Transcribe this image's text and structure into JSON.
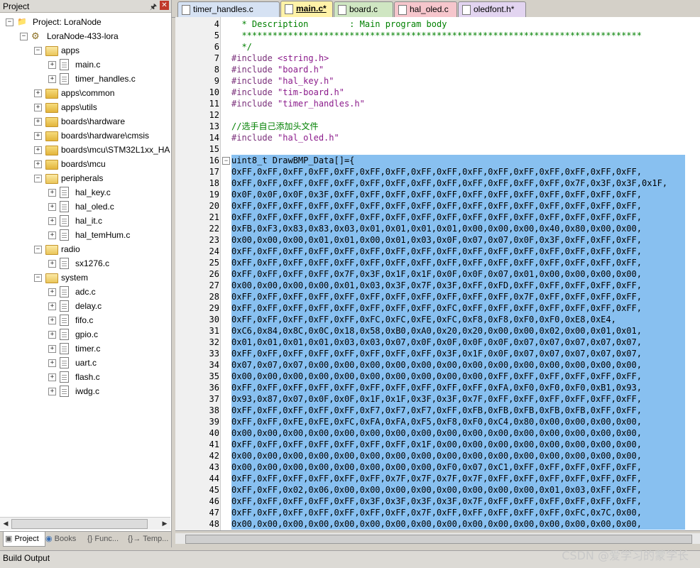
{
  "project_panel": {
    "title": "Project",
    "pin_icon": "pin-icon",
    "close_icon": "close-icon",
    "tree": [
      {
        "label": "Project: LoraNode",
        "depth": 0,
        "kind": "project",
        "expanded": true
      },
      {
        "label": "LoraNode-433-lora",
        "depth": 1,
        "kind": "target",
        "expanded": true
      },
      {
        "label": "apps",
        "depth": 2,
        "kind": "folder",
        "expanded": true
      },
      {
        "label": "main.c",
        "depth": 3,
        "kind": "file"
      },
      {
        "label": "timer_handles.c",
        "depth": 3,
        "kind": "file"
      },
      {
        "label": "apps\\common",
        "depth": 2,
        "kind": "folder",
        "expanded": false
      },
      {
        "label": "apps\\utils",
        "depth": 2,
        "kind": "folder",
        "expanded": false
      },
      {
        "label": "boards\\hardware",
        "depth": 2,
        "kind": "folder",
        "expanded": false
      },
      {
        "label": "boards\\hardware\\cmsis",
        "depth": 2,
        "kind": "folder",
        "expanded": false
      },
      {
        "label": "boards\\mcu\\STM32L1xx_HA",
        "depth": 2,
        "kind": "folder",
        "expanded": false
      },
      {
        "label": "boards\\mcu",
        "depth": 2,
        "kind": "folder",
        "expanded": false
      },
      {
        "label": "peripherals",
        "depth": 2,
        "kind": "folder",
        "expanded": true
      },
      {
        "label": "hal_key.c",
        "depth": 3,
        "kind": "file"
      },
      {
        "label": "hal_oled.c",
        "depth": 3,
        "kind": "file"
      },
      {
        "label": "hal_it.c",
        "depth": 3,
        "kind": "file"
      },
      {
        "label": "hal_temHum.c",
        "depth": 3,
        "kind": "file"
      },
      {
        "label": "radio",
        "depth": 2,
        "kind": "folder",
        "expanded": true
      },
      {
        "label": "sx1276.c",
        "depth": 3,
        "kind": "file"
      },
      {
        "label": "system",
        "depth": 2,
        "kind": "folder",
        "expanded": true
      },
      {
        "label": "adc.c",
        "depth": 3,
        "kind": "file"
      },
      {
        "label": "delay.c",
        "depth": 3,
        "kind": "file"
      },
      {
        "label": "fifo.c",
        "depth": 3,
        "kind": "file"
      },
      {
        "label": "gpio.c",
        "depth": 3,
        "kind": "file"
      },
      {
        "label": "timer.c",
        "depth": 3,
        "kind": "file"
      },
      {
        "label": "uart.c",
        "depth": 3,
        "kind": "file"
      },
      {
        "label": "flash.c",
        "depth": 3,
        "kind": "file"
      },
      {
        "label": "iwdg.c",
        "depth": 3,
        "kind": "file"
      }
    ],
    "tabs": [
      {
        "label": "Project",
        "icon": "project-icon",
        "active": true
      },
      {
        "label": "Books",
        "icon": "books-icon",
        "active": false
      },
      {
        "label": "{} Func...",
        "icon": "functions-icon",
        "active": false
      },
      {
        "label": "{}→ Temp...",
        "icon": "templates-icon",
        "active": false
      }
    ]
  },
  "editor_tabs": [
    {
      "label": "timer_handles.c",
      "color": "#d6e2f3",
      "active": false
    },
    {
      "label": "main.c*",
      "color": "#fff2a8",
      "active": true
    },
    {
      "label": "board.c",
      "color": "#cfe6c2",
      "active": false
    },
    {
      "label": "hal_oled.c",
      "color": "#f6c6cc",
      "active": false
    },
    {
      "label": "oledfont.h*",
      "color": "#e2d4f0",
      "active": false
    }
  ],
  "code_lines": [
    {
      "n": "4",
      "sel": false,
      "segs": [
        {
          "t": "  * Description        : Main program body",
          "c": "cm"
        }
      ]
    },
    {
      "n": "5",
      "sel": false,
      "segs": [
        {
          "t": "  ******************************************************************************",
          "c": "cm"
        }
      ]
    },
    {
      "n": "6",
      "sel": false,
      "segs": [
        {
          "t": "  */",
          "c": "cm"
        }
      ]
    },
    {
      "n": "7",
      "sel": false,
      "segs": [
        {
          "t": "#include ",
          "c": "pp"
        },
        {
          "t": "<string.h>",
          "c": "str"
        }
      ]
    },
    {
      "n": "8",
      "sel": false,
      "segs": [
        {
          "t": "#include ",
          "c": "pp"
        },
        {
          "t": "\"board.h\"",
          "c": "str"
        }
      ]
    },
    {
      "n": "9",
      "sel": false,
      "segs": [
        {
          "t": "#include ",
          "c": "pp"
        },
        {
          "t": "\"hal_key.h\"",
          "c": "str"
        }
      ]
    },
    {
      "n": "10",
      "sel": false,
      "segs": [
        {
          "t": "#include ",
          "c": "pp"
        },
        {
          "t": "\"tim-board.h\"",
          "c": "str"
        }
      ]
    },
    {
      "n": "11",
      "sel": false,
      "segs": [
        {
          "t": "#include ",
          "c": "pp"
        },
        {
          "t": "\"timer_handles.h\"",
          "c": "str"
        }
      ]
    },
    {
      "n": "12",
      "sel": false,
      "segs": [
        {
          "t": "",
          "c": "plain"
        }
      ]
    },
    {
      "n": "13",
      "sel": false,
      "segs": [
        {
          "t": "//选手自己添加头文件",
          "c": "cm"
        }
      ]
    },
    {
      "n": "14",
      "sel": false,
      "segs": [
        {
          "t": "#include ",
          "c": "pp"
        },
        {
          "t": "\"hal_oled.h\"",
          "c": "str"
        }
      ]
    },
    {
      "n": "15",
      "sel": false,
      "segs": [
        {
          "t": "",
          "c": "plain"
        }
      ]
    },
    {
      "n": "16",
      "sel": true,
      "fold": true,
      "segs": [
        {
          "t": "uint8_t DrawBMP_Data[]={",
          "c": "plain"
        }
      ]
    },
    {
      "n": "17",
      "sel": true,
      "segs": [
        {
          "t": "0xFF,0xFF,0xFF,0xFF,0xFF,0xFF,0xFF,0xFF,0xFF,0xFF,0xFF,0xFF,0xFF,0xFF,0xFF,0xFF,",
          "c": "plain"
        }
      ]
    },
    {
      "n": "18",
      "sel": true,
      "segs": [
        {
          "t": "0xFF,0xFF,0xFF,0xFF,0xFF,0xFF,0xFF,0xFF,0xFF,0xFF,0xFF,0xFF,0xFF,0x7F,0x3F,0x3F,0x1F,",
          "c": "plain"
        }
      ]
    },
    {
      "n": "19",
      "sel": true,
      "segs": [
        {
          "t": "0x0F,0x0F,0x0F,0x3F,0xFF,0xFF,0xFF,0xFF,0xFF,0xFF,0xFF,0xFF,0xFF,0xFF,0xFF,0xFF,",
          "c": "plain"
        }
      ]
    },
    {
      "n": "20",
      "sel": true,
      "segs": [
        {
          "t": "0xFF,0xFF,0xFF,0xFF,0xFF,0xFF,0xFF,0xFF,0xFF,0xFF,0xFF,0xFF,0xFF,0xFF,0xFF,0xFF,",
          "c": "plain"
        }
      ]
    },
    {
      "n": "21",
      "sel": true,
      "segs": [
        {
          "t": "0xFF,0xFF,0xFF,0xFF,0xFF,0xFF,0xFF,0xFF,0xFF,0xFF,0xFF,0xFF,0xFF,0xFF,0xFF,0xFF,",
          "c": "plain"
        }
      ]
    },
    {
      "n": "22",
      "sel": true,
      "segs": [
        {
          "t": "0xFB,0xF3,0x83,0x83,0x03,0x01,0x01,0x01,0x01,0x00,0x00,0x00,0x40,0x80,0x00,0x00,",
          "c": "plain"
        }
      ]
    },
    {
      "n": "23",
      "sel": true,
      "segs": [
        {
          "t": "0x00,0x00,0x00,0x01,0x01,0x00,0x01,0x03,0x0F,0x07,0x07,0x0F,0x3F,0xFF,0xFF,0xFF,",
          "c": "plain"
        }
      ]
    },
    {
      "n": "24",
      "sel": true,
      "segs": [
        {
          "t": "0xFF,0xFF,0xFF,0xFF,0xFF,0xFF,0xFF,0xFF,0xFF,0xFF,0xFF,0xFF,0xFF,0xFF,0xFF,0xFF,",
          "c": "plain"
        }
      ]
    },
    {
      "n": "25",
      "sel": true,
      "segs": [
        {
          "t": "0xFF,0xFF,0xFF,0xFF,0xFF,0xFF,0xFF,0xFF,0xFF,0xFF,0xFF,0xFF,0xFF,0xFF,0xFF,0xFF,",
          "c": "plain"
        }
      ]
    },
    {
      "n": "26",
      "sel": true,
      "segs": [
        {
          "t": "0xFF,0xFF,0xFF,0xFF,0x7F,0x3F,0x1F,0x1F,0x0F,0x0F,0x07,0x01,0x00,0x00,0x00,0x00,",
          "c": "plain"
        }
      ]
    },
    {
      "n": "27",
      "sel": true,
      "segs": [
        {
          "t": "0x00,0x00,0x00,0x00,0x01,0x03,0x3F,0x7F,0x3F,0xFF,0xFD,0xFF,0xFF,0xFF,0xFF,0xFF,",
          "c": "plain"
        }
      ]
    },
    {
      "n": "28",
      "sel": true,
      "segs": [
        {
          "t": "0xFF,0xFF,0xFF,0xFF,0xFF,0xFF,0xFF,0xFF,0xFF,0xFF,0xFF,0x7F,0xFF,0xFF,0xFF,0xFF,",
          "c": "plain"
        }
      ]
    },
    {
      "n": "29",
      "sel": true,
      "segs": [
        {
          "t": "0xFF,0xFF,0xFF,0xFF,0xFF,0xFF,0xFF,0xFF,0xFC,0xFF,0xFF,0xFF,0xFF,0xFF,0xFF,0xFF,",
          "c": "plain"
        }
      ]
    },
    {
      "n": "30",
      "sel": true,
      "segs": [
        {
          "t": "0xFF,0xFF,0xFF,0xFF,0xFF,0xFC,0xFC,0xFE,0xFC,0xF8,0xF8,0xF0,0xF0,0xE8,0xE4,",
          "c": "plain"
        }
      ]
    },
    {
      "n": "31",
      "sel": true,
      "segs": [
        {
          "t": "0xC6,0x84,0x8C,0x0C,0x18,0x58,0xB0,0xA0,0x20,0x20,0x00,0x00,0x02,0x00,0x01,0x01,",
          "c": "plain"
        }
      ]
    },
    {
      "n": "32",
      "sel": true,
      "segs": [
        {
          "t": "0x01,0x01,0x01,0x01,0x03,0x03,0x07,0x0F,0x0F,0x0F,0x0F,0x07,0x07,0x07,0x07,0x07,",
          "c": "plain"
        }
      ]
    },
    {
      "n": "33",
      "sel": true,
      "segs": [
        {
          "t": "0xFF,0xFF,0xFF,0xFF,0xFF,0xFF,0xFF,0xFF,0x3F,0x1F,0x0F,0x07,0x07,0x07,0x07,0x07,",
          "c": "plain"
        }
      ]
    },
    {
      "n": "34",
      "sel": true,
      "segs": [
        {
          "t": "0x07,0x07,0x07,0x00,0x00,0x00,0x00,0x00,0x00,0x00,0x00,0x00,0x00,0x00,0x00,0x00,",
          "c": "plain"
        }
      ]
    },
    {
      "n": "35",
      "sel": true,
      "segs": [
        {
          "t": "0x00,0x00,0x00,0x00,0x00,0x00,0x00,0x00,0x00,0x00,0xFF,0xFF,0xFF,0xFF,0xFF,0xFF,",
          "c": "plain"
        }
      ]
    },
    {
      "n": "36",
      "sel": true,
      "segs": [
        {
          "t": "0xFF,0xFF,0xFF,0xFF,0xFF,0xFF,0xFF,0xFF,0xFF,0xFF,0xFA,0xF0,0xF0,0xF0,0xB1,0x93,",
          "c": "plain"
        }
      ]
    },
    {
      "n": "37",
      "sel": true,
      "segs": [
        {
          "t": "0x93,0x87,0x07,0x0F,0x0F,0x1F,0x1F,0x3F,0x3F,0x7F,0xFF,0xFF,0xFF,0xFF,0xFF,0xFF,",
          "c": "plain"
        }
      ]
    },
    {
      "n": "38",
      "sel": true,
      "segs": [
        {
          "t": "0xFF,0xFF,0xFF,0xFF,0xFF,0xF7,0xF7,0xF7,0xFF,0xFB,0xFB,0xFB,0xFB,0xFB,0xFF,0xFF,",
          "c": "plain"
        }
      ]
    },
    {
      "n": "39",
      "sel": true,
      "segs": [
        {
          "t": "0xFF,0xFF,0xFE,0xFE,0xFC,0xFA,0xFA,0xF5,0xF8,0xF0,0xC4,0x80,0x00,0x00,0x00,0x00,",
          "c": "plain"
        }
      ]
    },
    {
      "n": "40",
      "sel": true,
      "segs": [
        {
          "t": "0x00,0x00,0x00,0x00,0x00,0x00,0x00,0x00,0x00,0x00,0x00,0x00,0x00,0x00,0x00,0x00,",
          "c": "plain"
        }
      ]
    },
    {
      "n": "41",
      "sel": true,
      "segs": [
        {
          "t": "0xFF,0xFF,0xFF,0xFF,0xFF,0xFF,0xFF,0x1F,0x00,0x00,0x00,0x00,0x00,0x00,0x00,0x00,",
          "c": "plain"
        }
      ]
    },
    {
      "n": "42",
      "sel": true,
      "segs": [
        {
          "t": "0x00,0x00,0x00,0x00,0x00,0x00,0x00,0x00,0x00,0x00,0x00,0x00,0x00,0x00,0x00,0x00,",
          "c": "plain"
        }
      ]
    },
    {
      "n": "43",
      "sel": true,
      "segs": [
        {
          "t": "0x00,0x00,0x00,0x00,0x00,0x00,0x00,0x00,0xF0,0x07,0xC1,0xFF,0xFF,0xFF,0xFF,0xFF,",
          "c": "plain"
        }
      ]
    },
    {
      "n": "44",
      "sel": true,
      "segs": [
        {
          "t": "0xFF,0xFF,0xFF,0xFF,0xFF,0xFF,0x7F,0x7F,0x7F,0x7F,0xFF,0xFF,0xFF,0xFF,0xFF,0xFF,",
          "c": "plain"
        }
      ]
    },
    {
      "n": "45",
      "sel": true,
      "segs": [
        {
          "t": "0xFF,0xFF,0x02,0x06,0x00,0x00,0x00,0x00,0x00,0x00,0x00,0x00,0x01,0x03,0xFF,0xFF,",
          "c": "plain"
        }
      ]
    },
    {
      "n": "46",
      "sel": true,
      "segs": [
        {
          "t": "0xFF,0xFF,0xFF,0xFF,0xFF,0x3F,0x3F,0x3F,0x3F,0x7F,0xFF,0xFF,0xFF,0xFF,0xFF,0xFF,",
          "c": "plain"
        }
      ]
    },
    {
      "n": "47",
      "sel": true,
      "segs": [
        {
          "t": "0xFF,0xFF,0xFF,0xFF,0xFF,0xFF,0xFF,0x7F,0xFF,0xFF,0xFF,0xFF,0xFF,0xFC,0x7C,0x00,",
          "c": "plain"
        }
      ]
    },
    {
      "n": "48",
      "sel": true,
      "segs": [
        {
          "t": "0x00,0x00,0x00,0x00,0x00,0x00,0x00,0x00,0x00,0x00,0x00,0x00,0x00,0x00,0x00,0x00,",
          "c": "plain"
        }
      ]
    }
  ],
  "build_output": {
    "title": "Build Output"
  },
  "watermark": "CSDN @爱学习的蒙学长",
  "colors": {
    "selection": "#88c0f0",
    "comment": "#008000",
    "preprocessor": "#7a2f7a",
    "string": "#8b1a8b"
  }
}
